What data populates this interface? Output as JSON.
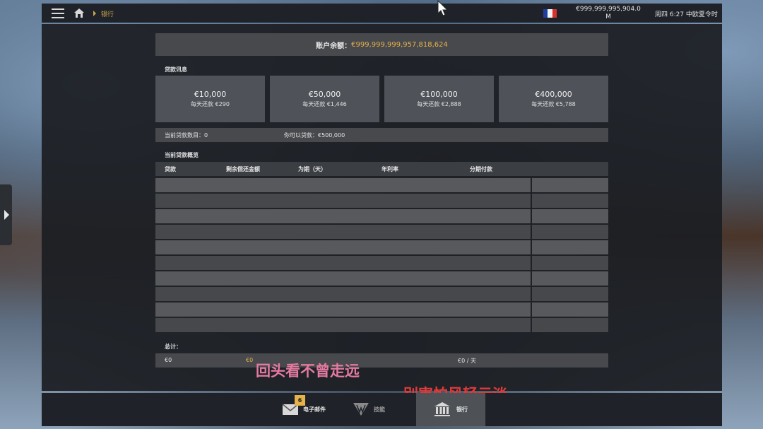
{
  "topbar": {
    "breadcrumb": "银行",
    "money_line1": "€999,999,995,904.0",
    "money_line2": "M",
    "clock": "周四 6:27 中欧夏令时"
  },
  "balance": {
    "label": "账户余额：",
    "value": "€999,999,999,957,818,624"
  },
  "loan_info_label": "贷款讯息",
  "loan_options": [
    {
      "amount": "€10,000",
      "daily": "每天还款 €290"
    },
    {
      "amount": "€50,000",
      "daily": "每天还款 €1,446"
    },
    {
      "amount": "€100,000",
      "daily": "每天还款 €2,888"
    },
    {
      "amount": "€400,000",
      "daily": "每天还款 €5,788"
    }
  ],
  "info_bar": {
    "current_count": "当前贷款数目：0",
    "can_borrow": "你可以贷款：€500,000"
  },
  "overview_label": "当前贷款概览",
  "table_headers": {
    "loan": "贷款",
    "remaining": "剩余偿还金额",
    "term": "为期（天）",
    "rate": "年利率",
    "installment": "分期付款"
  },
  "total": {
    "label": "总计：",
    "col1": "€0",
    "col2": "€0",
    "col3": "€0 / 天"
  },
  "overlay": {
    "line1": "回头看不曾走远",
    "line2": "别害怕风轻云淡"
  },
  "bottom_nav": {
    "email": "电子邮件",
    "email_badge": "6",
    "skills": "技能",
    "bank": "银行"
  },
  "colors": {
    "accent": "#e8b24a",
    "overlay_pink": "#e47aa0",
    "overlay_red": "#e03a3a"
  }
}
